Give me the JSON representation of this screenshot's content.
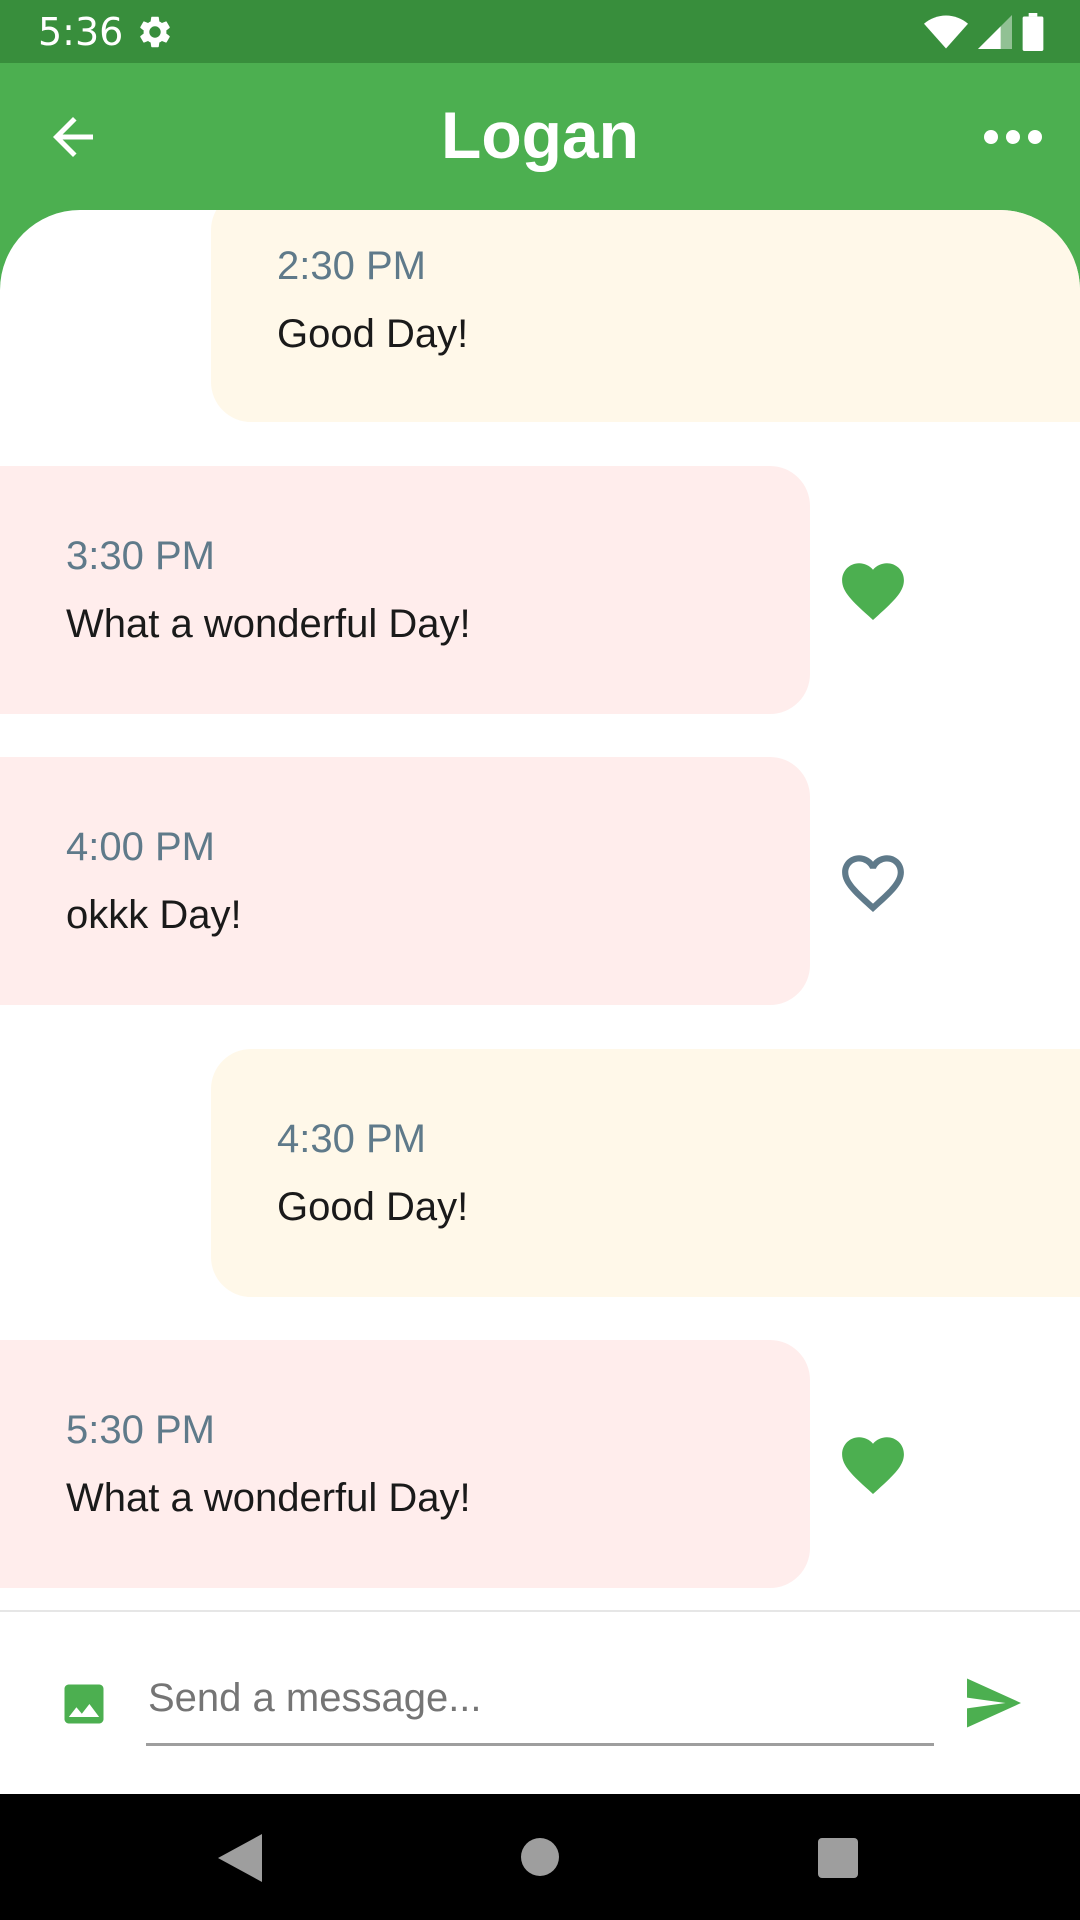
{
  "status_bar": {
    "time": "5:36",
    "icons": [
      "settings-icon",
      "wifi-icon",
      "signal-icon",
      "battery-icon"
    ]
  },
  "app_bar": {
    "title": "Logan",
    "back_icon": "arrow-back-icon",
    "menu_icon": "more-horiz-icon"
  },
  "messages": [
    {
      "type": "sent",
      "time": "2:30 PM",
      "text": "Good Day!"
    },
    {
      "type": "received",
      "time": "3:30 PM",
      "text": "What a wonderful Day!",
      "liked": true
    },
    {
      "type": "received",
      "time": "4:00 PM",
      "text": "okkk Day!",
      "liked": false
    },
    {
      "type": "sent",
      "time": "4:30 PM",
      "text": "Good Day!"
    },
    {
      "type": "received",
      "time": "5:30 PM",
      "text": "What a wonderful Day!",
      "liked": true
    }
  ],
  "composer": {
    "placeholder": "Send a message...",
    "value": "",
    "gallery_icon": "image-icon",
    "send_icon": "send-icon"
  },
  "colors": {
    "primary": "#4CAF50",
    "status_bar": "#388E3C",
    "sent_bubble": "#FFF8E9",
    "received_bubble": "#FFEDEC",
    "time_text": "#5F7A8A",
    "heart_outline": "#5F7A8A"
  }
}
